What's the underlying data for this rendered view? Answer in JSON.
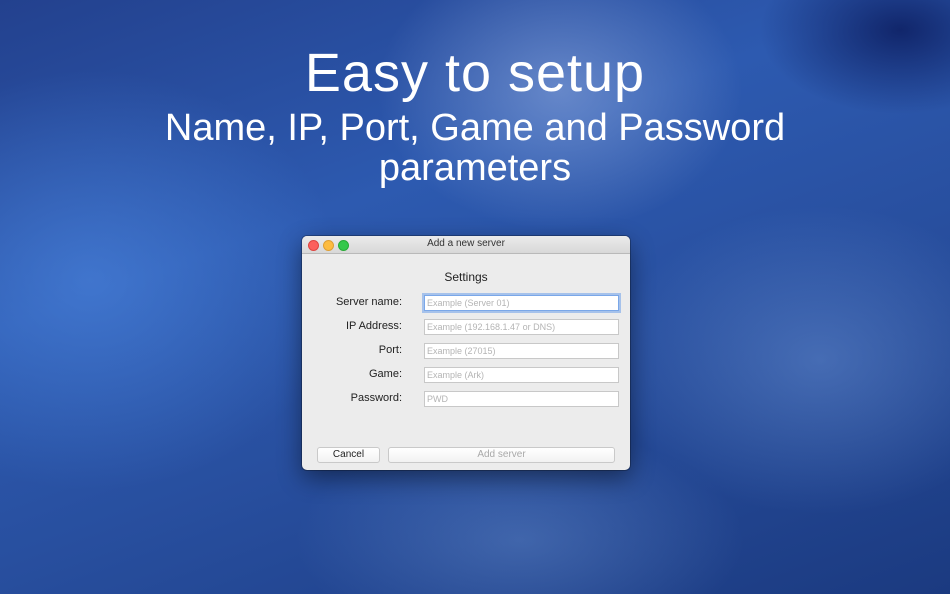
{
  "headline": {
    "title": "Easy to setup",
    "subtitle": "Name, IP, Port, Game and Password parameters"
  },
  "window": {
    "title": "Add a new server",
    "section_title": "Settings",
    "fields": [
      {
        "label": "Server name:",
        "placeholder": "Example (Server 01)"
      },
      {
        "label": "IP Address:",
        "placeholder": "Example (192.168.1.47 or DNS)"
      },
      {
        "label": "Port:",
        "placeholder": "Example (27015)"
      },
      {
        "label": "Game:",
        "placeholder": "Example (Ark)"
      },
      {
        "label": "Password:",
        "placeholder": "PWD"
      }
    ],
    "buttons": {
      "cancel": "Cancel",
      "add": "Add server"
    }
  }
}
